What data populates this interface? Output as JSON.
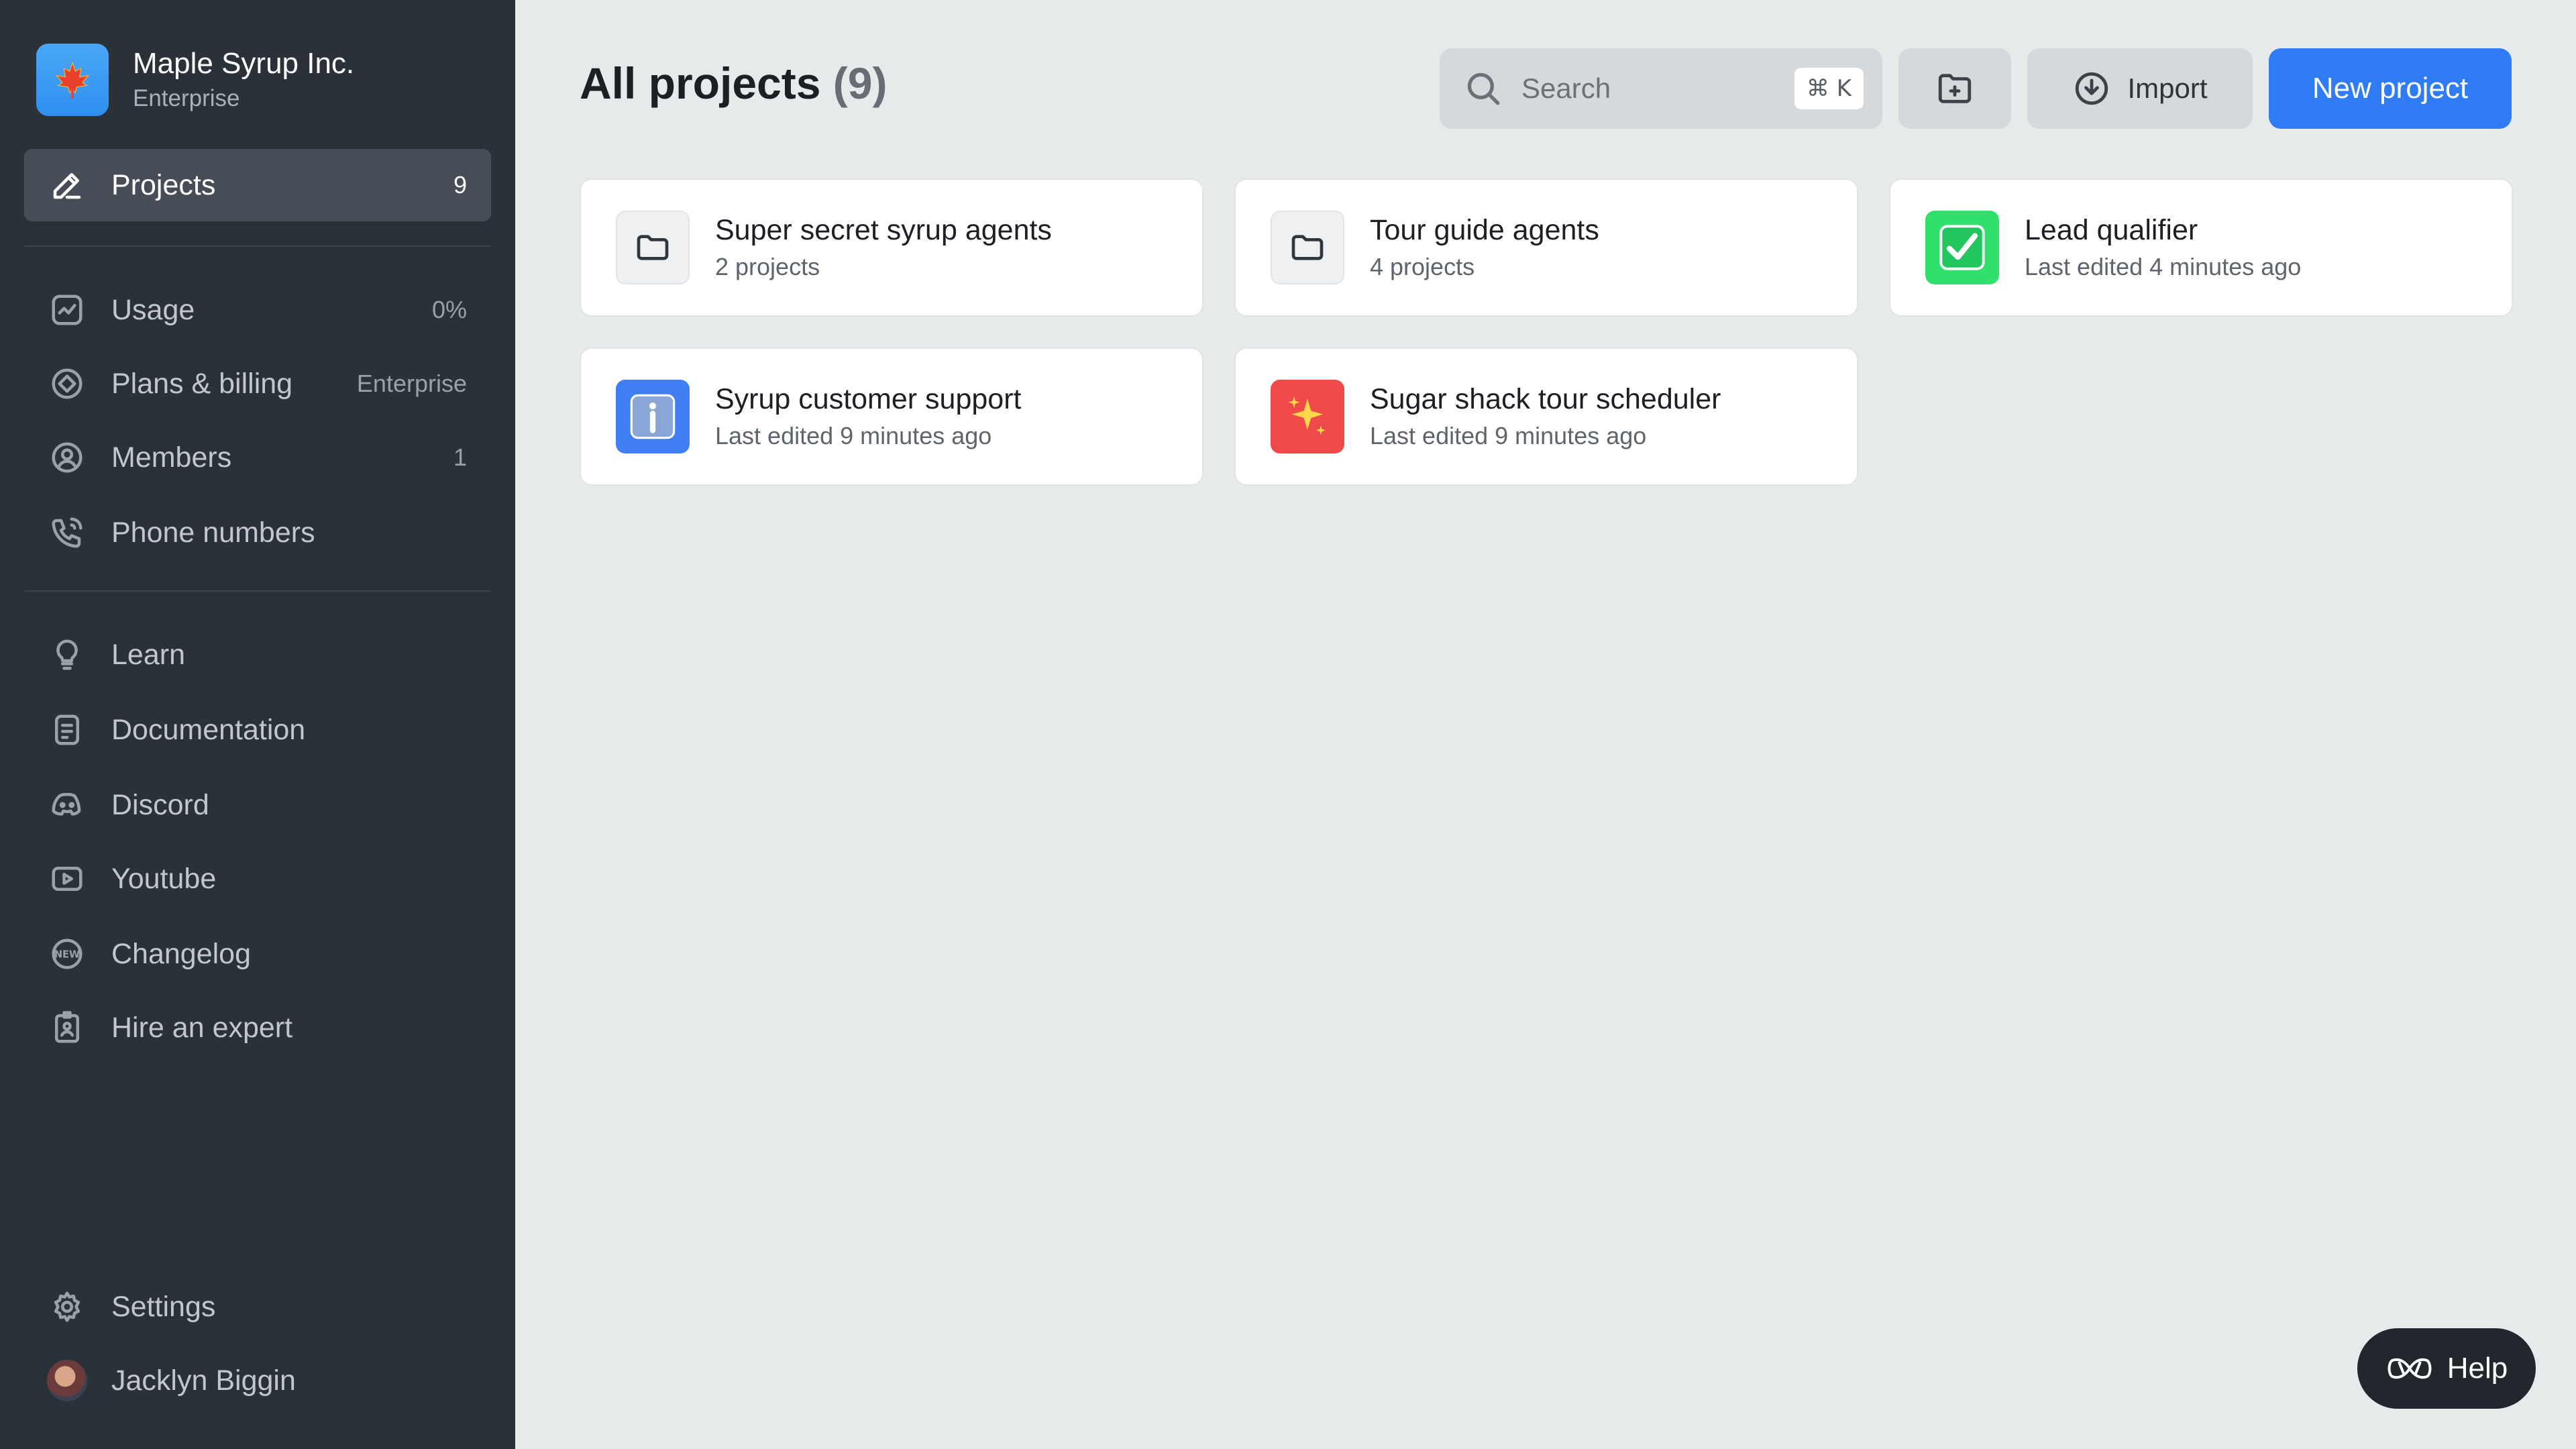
{
  "org": {
    "name": "Maple Syrup Inc.",
    "plan": "Enterprise",
    "logo_glyph": "🍁"
  },
  "sidebar": {
    "primary": [
      {
        "label": "Projects",
        "meta": "9",
        "icon": "pencil-icon"
      }
    ],
    "account": [
      {
        "label": "Usage",
        "meta": "0%",
        "icon": "usage-chart-icon"
      },
      {
        "label": "Plans & billing",
        "meta": "Enterprise",
        "icon": "billing-icon"
      },
      {
        "label": "Members",
        "meta": "1",
        "icon": "user-circle-icon"
      },
      {
        "label": "Phone numbers",
        "meta": "",
        "icon": "phone-icon"
      }
    ],
    "resources": [
      {
        "label": "Learn",
        "icon": "lightbulb-icon"
      },
      {
        "label": "Documentation",
        "icon": "document-icon"
      },
      {
        "label": "Discord",
        "icon": "discord-icon"
      },
      {
        "label": "Youtube",
        "icon": "youtube-icon"
      },
      {
        "label": "Changelog",
        "icon": "new-badge-icon"
      },
      {
        "label": "Hire an expert",
        "icon": "badge-icon"
      }
    ],
    "bottom": {
      "settings_label": "Settings",
      "user_name": "Jacklyn Biggin"
    }
  },
  "header": {
    "title": "All projects",
    "count": "(9)",
    "search_placeholder": "Search",
    "search_shortcut": "⌘ K",
    "import_label": "Import",
    "new_project_label": "New project"
  },
  "cards": [
    {
      "title": "Super secret syrup agents",
      "subtitle": "2 projects",
      "icon": "folder-icon"
    },
    {
      "title": "Tour guide agents",
      "subtitle": "4 projects",
      "icon": "folder-icon"
    },
    {
      "title": "Lead qualifier",
      "subtitle": "Last edited 4 minutes ago",
      "icon": "check-mark-icon"
    },
    {
      "title": "Syrup customer support",
      "subtitle": "Last edited 9 minutes ago",
      "icon": "info-icon"
    },
    {
      "title": "Sugar shack tour scheduler",
      "subtitle": "Last edited 9 minutes ago",
      "icon": "sparkles-icon"
    }
  ],
  "help": {
    "label": "Help"
  },
  "colors": {
    "sidebar_bg": "#2b3139",
    "main_bg": "#e7eaeb",
    "accent": "#2f7cf6",
    "active_item": "#474d56"
  }
}
